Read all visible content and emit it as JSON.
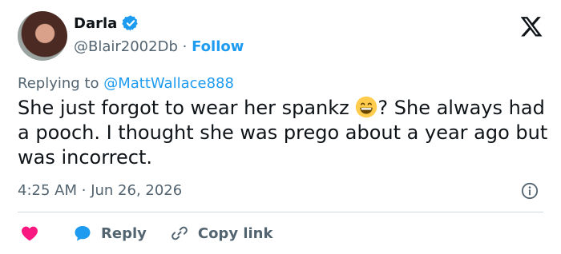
{
  "tweet": {
    "author_name": "Darla",
    "handle": "@Blair2002Db",
    "separator": "·",
    "follow_label": "Follow",
    "reply_prefix": "Replying to",
    "reply_mention": "@MattWallace888",
    "text_part1": "She just forgot to wear her spankz",
    "text_part2": "? She always had a pooch. I thought she was prego about a year ago but was incorrect.",
    "time": "4:25 AM",
    "date_separator": "·",
    "date": "Jun 26, 2026"
  },
  "actions": {
    "reply_label": "Reply",
    "copy_link_label": "Copy link"
  },
  "icons": {
    "verified": "verified-badge-icon",
    "logo": "x-logo-icon",
    "emoji": "grinning-face-emoji",
    "info": "info-icon",
    "like": "heart-icon",
    "reply": "comment-bubble-icon",
    "copy": "link-icon"
  },
  "colors": {
    "accent": "#1d9bf0",
    "like": "#f91880",
    "muted": "#536471",
    "text": "#0f1419"
  }
}
